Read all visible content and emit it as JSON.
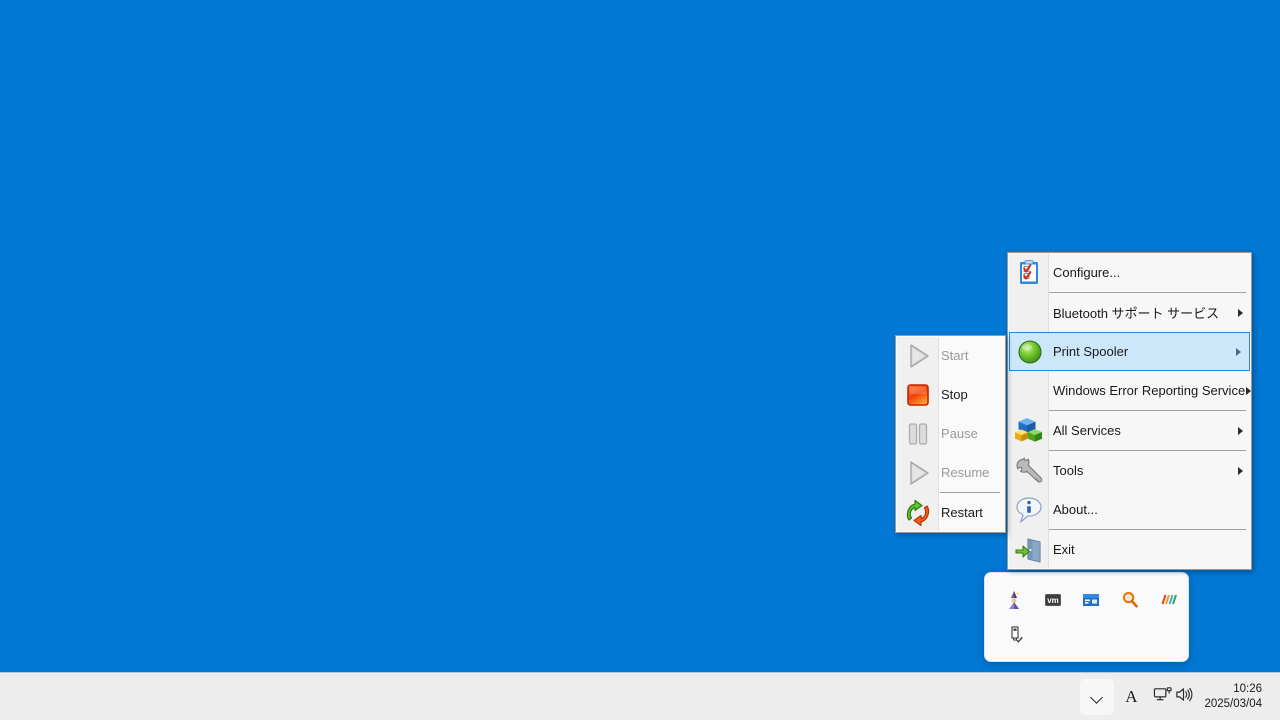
{
  "desktop": {
    "background_color": "#0078d4"
  },
  "service_menu": {
    "name": "service-tray-context-menu",
    "items": [
      {
        "id": "configure",
        "label": "Configure...",
        "icon": "checklist-icon",
        "submenu": false,
        "separator_after": true
      },
      {
        "id": "bluetooth",
        "label": "Bluetooth サポート サービス",
        "icon": "none",
        "submenu": true,
        "separator_after": false
      },
      {
        "id": "spooler",
        "label": "Print Spooler",
        "icon": "green-circle-running-icon",
        "submenu": true,
        "selected": true,
        "separator_after": false
      },
      {
        "id": "wers",
        "label": "Windows Error Reporting Service",
        "icon": "none",
        "submenu": true,
        "separator_after": true
      },
      {
        "id": "allservices",
        "label": "All Services",
        "icon": "blocks-icon",
        "submenu": true,
        "separator_after": true
      },
      {
        "id": "tools",
        "label": "Tools",
        "icon": "wrench-icon",
        "submenu": true,
        "separator_after": false
      },
      {
        "id": "about",
        "label": "About...",
        "icon": "info-balloon-icon",
        "submenu": false,
        "separator_after": true
      },
      {
        "id": "exit",
        "label": "Exit",
        "icon": "exit-door-icon",
        "submenu": false,
        "separator_after": false
      }
    ],
    "highlight_color": "#cce6fa",
    "highlight_border_color": "#2e87d8"
  },
  "service_submenu": {
    "name": "print-spooler-actions-submenu",
    "items": [
      {
        "id": "start",
        "label": "Start",
        "icon": "play-triangle-icon",
        "enabled": false,
        "separator_after": false
      },
      {
        "id": "stop",
        "label": "Stop",
        "icon": "stop-square-icon",
        "enabled": true,
        "separator_after": false
      },
      {
        "id": "pause",
        "label": "Pause",
        "icon": "pause-bars-icon",
        "enabled": false,
        "separator_after": false
      },
      {
        "id": "resume",
        "label": "Resume",
        "icon": "play-triangle-icon",
        "enabled": false,
        "separator_after": true
      },
      {
        "id": "restart",
        "label": "Restart",
        "icon": "restart-arrows-icon",
        "enabled": true,
        "separator_after": false
      }
    ]
  },
  "tray_flyout": {
    "name": "hidden-icons-flyout",
    "icons": [
      {
        "id": "wizard",
        "name": "wizard-icon"
      },
      {
        "id": "vmware",
        "name": "vm-icon"
      },
      {
        "id": "display",
        "name": "display-settings-icon"
      },
      {
        "id": "search",
        "name": "magnifier-icon"
      },
      {
        "id": "stripes",
        "name": "colored-stripes-icon"
      },
      {
        "id": "usb",
        "name": "safely-remove-usb-icon"
      }
    ]
  },
  "taskbar": {
    "show_hidden_icons_label": "",
    "ime_label": "A",
    "network_icon": "network-icon",
    "volume_icon": "volume-icon",
    "clock": {
      "time": "10:26",
      "date": "2025/03/04"
    }
  }
}
